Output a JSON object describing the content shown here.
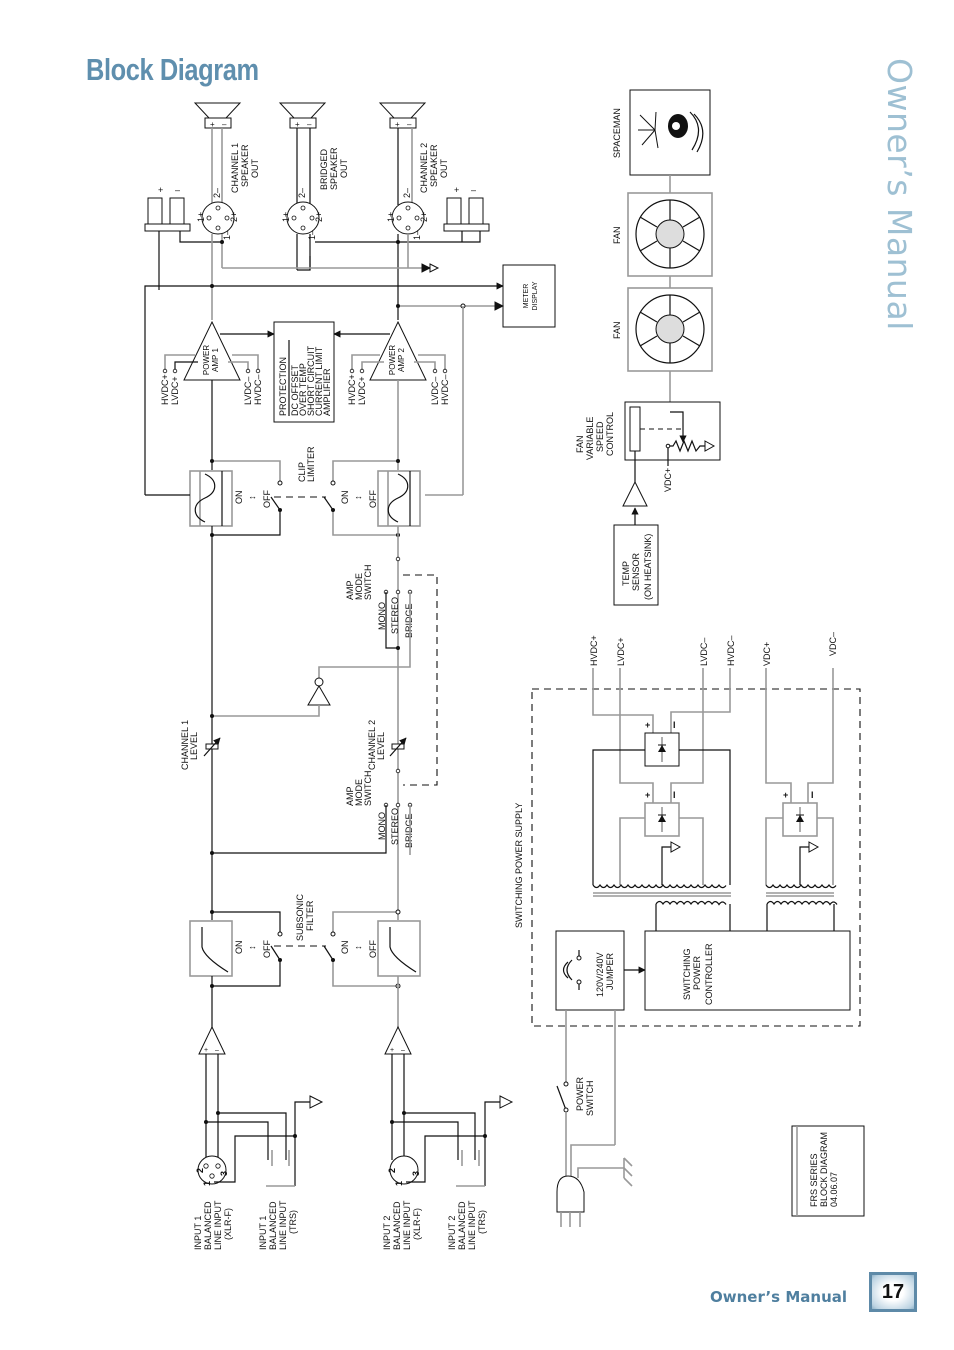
{
  "page": {
    "title": "Block Diagram",
    "side_title": "Owner’s Manual",
    "footer_label": "Owner’s Manual",
    "page_number": "17"
  },
  "colors": {
    "title_blue": "#5f8fae",
    "side_title_blue": "#9ec0d3",
    "footer_blue": "#4f7f9f",
    "wire_black": "#111111",
    "wire_gray": "#999999"
  },
  "speakers": {
    "ch1": {
      "line1": "CHANNEL 1",
      "line2": "SPEAKER",
      "line3": "OUT"
    },
    "bridged": {
      "line1": "BRIDGED",
      "line2": "SPEAKER",
      "line3": "OUT"
    },
    "ch2": {
      "line1": "CHANNEL 2",
      "line2": "SPEAKER",
      "line3": "OUT"
    },
    "plus": "+",
    "minus": "–",
    "pins": {
      "p1plus": "1+",
      "p1minus": "1–",
      "p2plus": "2+",
      "p2minus": "2–"
    }
  },
  "power_amps": {
    "amp1": {
      "line1": "POWER",
      "line2": "AMP 1"
    },
    "amp2": {
      "line1": "POWER",
      "line2": "AMP 2"
    },
    "rails": {
      "hvdc_plus": "HVDC+",
      "lvdc_plus": "LVDC+",
      "lvdc_minus": "LVDC–",
      "hvdc_minus": "HVDC–"
    }
  },
  "protection": {
    "title": "PROTECTION",
    "items": [
      "DC OFFSET",
      "OVER TEMP",
      "SHORT CIRCUIT",
      "CURRENT LIMIT",
      "AMPLIFIER"
    ]
  },
  "meter": {
    "line1": "METER",
    "line2": "DISPLAY"
  },
  "clip_limiter": {
    "line1": "CLIP",
    "line2": "LIMITER",
    "on": "ON",
    "off": "OFF"
  },
  "amp_mode": {
    "line1": "AMP",
    "line2": "MODE",
    "line3": "SWITCH",
    "options": [
      "MONO",
      "STEREO",
      "BRIDGE"
    ]
  },
  "levels": {
    "ch1": {
      "line1": "CHANNEL 1",
      "line2": "LEVEL"
    },
    "ch2": {
      "line1": "CHANNEL 2",
      "line2": "LEVEL"
    }
  },
  "subsonic": {
    "line1": "SUBSONIC",
    "line2": "FILTER",
    "on": "ON",
    "off": "OFF"
  },
  "inputs": {
    "in1_xlr": [
      "INPUT 1",
      "BALANCED",
      "LINE INPUT",
      "(XLR-F)"
    ],
    "in1_trs": [
      "INPUT 1",
      "BALANCED",
      "LINE INPUT",
      "(TRS)"
    ],
    "in2_xlr": [
      "INPUT 2",
      "BALANCED",
      "LINE INPUT",
      "(XLR-F)"
    ],
    "in2_trs": [
      "INPUT 2",
      "BALANCED",
      "LINE INPUT",
      "(TRS)"
    ],
    "xlr_pins": [
      "1",
      "2",
      "3"
    ]
  },
  "cooling": {
    "spaceman": "SPACEMAN",
    "fan1": "FAN",
    "fan2": "FAN",
    "speed_control": [
      "FAN",
      "VARIABLE",
      "SPEED",
      "CONTROL"
    ],
    "vdc_plus": "VDC+",
    "temp_sensor": [
      "TEMP",
      "SENSOR",
      "(ON HEATSINK)"
    ]
  },
  "power_supply": {
    "label": "SWITCHING POWER SUPPLY",
    "outputs": [
      "HVDC+",
      "LVDC+",
      "LVDC–",
      "HVDC–",
      "VDC+",
      "VDC–"
    ],
    "controller": [
      "SWITCHING",
      "POWER",
      "CONTROLLER"
    ],
    "jumper": [
      "120V/240V",
      "JUMPER"
    ],
    "power_switch": [
      "POWER",
      "SWITCH"
    ]
  },
  "title_block": [
    "FRS SERIES",
    "BLOCK DIAGRAM",
    "04.06.07"
  ]
}
